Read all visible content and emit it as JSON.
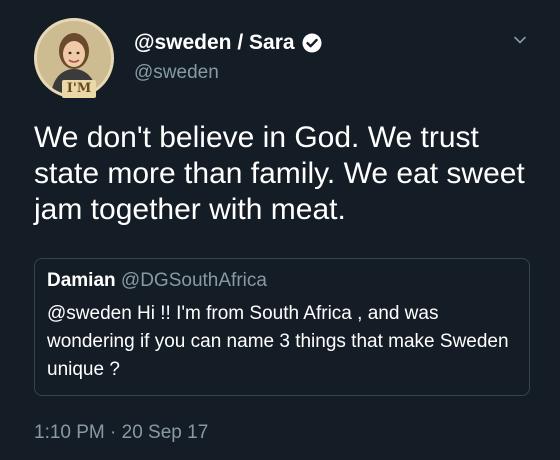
{
  "tweet": {
    "display_name": "@sweden / Sara",
    "handle": "@sweden",
    "avatar_badge": "I'M",
    "text": "We don't believe in God. We trust state more than family. We eat sweet jam together with meat.",
    "timestamp": "1:10 PM · 20 Sep 17",
    "icons": {
      "verified": "verified-badge-icon",
      "menu": "chevron-down-icon"
    }
  },
  "quoted_tweet": {
    "name": "Damian",
    "handle": "@DGSouthAfrica",
    "text": "@sweden Hi !! I'm from South Africa , and was wondering if you can name 3 things that make Sweden unique ?"
  },
  "colors": {
    "background": "#141d26",
    "secondary_text": "#8899a6",
    "border": "#38444d"
  }
}
